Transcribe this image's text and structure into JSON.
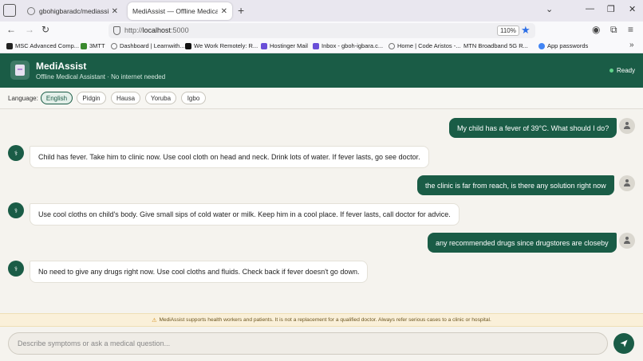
{
  "browser": {
    "tabs": [
      {
        "label": "gbohigbaradc/mediassist_subm",
        "active": false
      },
      {
        "label": "MediAssist — Offline Medical Assist",
        "active": true
      }
    ],
    "url_scheme": "http://",
    "url_host": "localhost",
    "url_port": ":5000",
    "zoom": "110%",
    "bookmarks": [
      {
        "label": "MSC Advanced Comp...",
        "icon_color": "#222222"
      },
      {
        "label": "3MTT",
        "icon_color": "#3a8a2e"
      },
      {
        "label": "Dashboard | Learnwith...",
        "icon_color": "#777777"
      },
      {
        "label": "We Work Remotely: R...",
        "icon_color": "#111111"
      },
      {
        "label": "Hostinger Mail",
        "icon_color": "#6a4fd8"
      },
      {
        "label": "Inbox - gboh-igbara.c...",
        "icon_color": "#6a4fd8"
      },
      {
        "label": "Home | Code Aristos -...",
        "icon_color": "#777777"
      },
      {
        "label": "MTN Broadband 5G R...",
        "icon_color": "#f5c400"
      },
      {
        "label": "App passwords",
        "icon_color": "#4285f4"
      }
    ]
  },
  "app": {
    "title": "MediAssist",
    "subtitle": "Offline Medical Assistant · No internet needed",
    "status": "Ready",
    "brand_color": "#1a5c46"
  },
  "language": {
    "label": "Language:",
    "options": [
      "English",
      "Pidgin",
      "Hausa",
      "Yoruba",
      "Igbo"
    ],
    "selected": "English"
  },
  "messages": [
    {
      "role": "user",
      "text": "My child has a fever of 39°C. What should I do?"
    },
    {
      "role": "bot",
      "text": "Child has fever. Take him to clinic now. Use cool cloth on head and neck. Drink lots of water. If fever lasts, go see doctor."
    },
    {
      "role": "user",
      "text": "the clinic is far from reach, is there any solution right now"
    },
    {
      "role": "bot",
      "text": "Use cool cloths on child's body. Give small sips of cold water or milk. Keep him in a cool place. If fever lasts, call doctor for advice."
    },
    {
      "role": "user",
      "text": "any recommended drugs since drugstores are closeby"
    },
    {
      "role": "bot",
      "text": "No need to give any drugs right now. Use cool cloths and fluids. Check back if fever doesn't go down."
    }
  ],
  "bot_avatar_glyph": "⚕",
  "disclaimer": {
    "icon": "warning-icon",
    "text": "MediAssist supports health workers and patients. It is not a replacement for a qualified doctor. Always refer serious cases to a clinic or hospital."
  },
  "input": {
    "placeholder": "Describe symptoms or ask a medical question...",
    "value": ""
  }
}
